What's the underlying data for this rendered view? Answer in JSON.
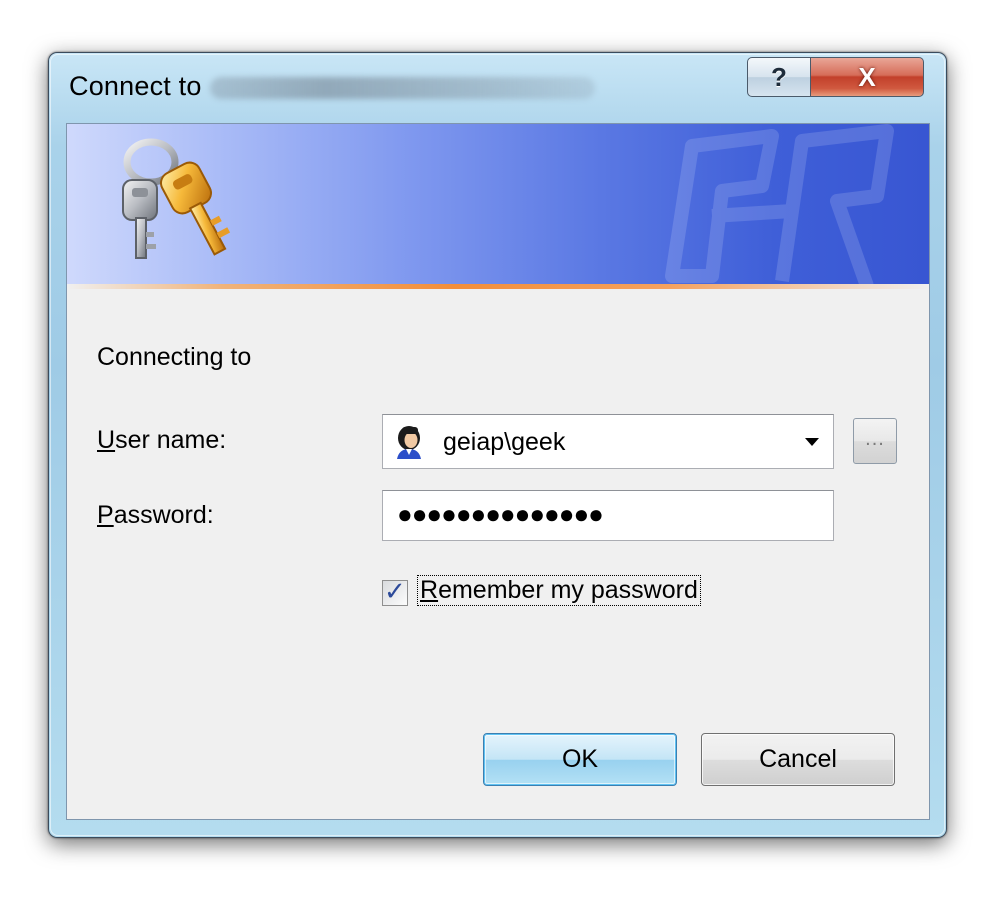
{
  "window": {
    "title": "Connect to",
    "help_glyph": "?",
    "close_glyph": "X"
  },
  "banner": {
    "icon": "keys-icon",
    "watermark": "ghost-logo-watermark"
  },
  "body": {
    "connecting_label": "Connecting to",
    "username_label_mnemonic": "U",
    "username_label_rest": "ser name:",
    "username_value": "geiap\\geek",
    "browse_label": "...",
    "password_label_mnemonic": "P",
    "password_label_rest": "assword:",
    "password_value": "●●●●●●●●●●●●●●",
    "remember_label_mnemonic": "R",
    "remember_label_rest": "emember my password",
    "remember_checked": true
  },
  "buttons": {
    "ok_label": "OK",
    "cancel_label": "Cancel"
  },
  "colors": {
    "banner_start": "#cfd9fc",
    "banner_end": "#3856d2",
    "accent_line": "#f28e3a",
    "ok_border": "#3c7fb1",
    "client_bg": "#f0f0f0"
  }
}
